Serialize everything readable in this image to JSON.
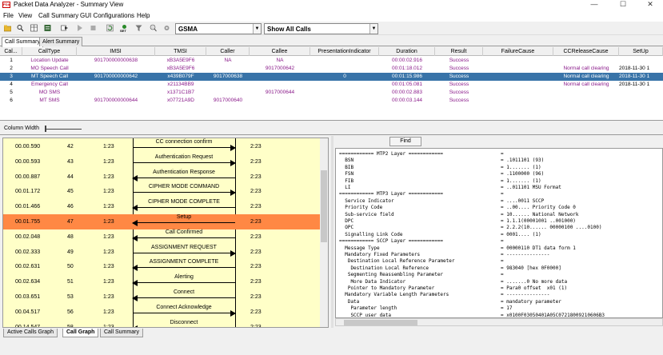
{
  "window": {
    "icon_text": "PDA",
    "title": "Packet Data Analyzer - Summary View",
    "minimize": "—",
    "maximize": "☐",
    "close": "✕"
  },
  "menu": [
    "File",
    "View",
    "Call Summary",
    "GUI Configurations",
    "Help"
  ],
  "toolbar": {
    "protocol_combo": "GSMA",
    "filter_combo": "Show All Calls",
    "set_label": "SET"
  },
  "top_tabs": [
    "Call Summary",
    "Alert Summary"
  ],
  "grid": {
    "headers": [
      "Cal...",
      "CallType",
      "IMSI",
      "TMSI",
      "Caller",
      "Callee",
      "PresentationIndicator",
      "Duration",
      "Result",
      "FailureCause",
      "CCReleaseCause",
      "SetUp"
    ],
    "rows": [
      [
        "1",
        "Location Update",
        "901700000000638",
        "xB3A5E9F6",
        "NA",
        "NA",
        "",
        "00:00:02.916",
        "Success",
        "",
        "",
        ""
      ],
      [
        "2",
        "MO Speech Call",
        "",
        "xB3A5E9F6",
        "",
        "9017000642",
        "",
        "00:01:18.012",
        "Success",
        "",
        "Normal call clearing",
        "2018-11-30 1"
      ],
      [
        "3",
        "MT Speech Call",
        "901700000000642",
        "x439B079F",
        "9017000638",
        "",
        "0",
        "00:01:15.986",
        "Success",
        "",
        "Normal call clearing",
        "2018-11-30 1"
      ],
      [
        "4",
        "Emergency Call",
        "",
        "x21134BB9",
        "",
        "",
        "",
        "00:01:05.081",
        "Success",
        "",
        "Normal call clearing",
        "2018-11-30 1"
      ],
      [
        "5",
        "MO SMS",
        "",
        "x1371C1B7",
        "",
        "9017000644",
        "",
        "00:00:02.883",
        "Success",
        "",
        "",
        ""
      ],
      [
        "6",
        "MT SMS",
        "901700000000644",
        "x07721A9D",
        "9017000640",
        "",
        "",
        "00:00:03.144",
        "Success",
        "",
        "",
        ""
      ]
    ],
    "selected_row": 2
  },
  "column_width_label": "Column Width",
  "find_label": "Find",
  "call_graph": {
    "events": [
      {
        "time": "00.00.590",
        "num": "42",
        "left": "1:23",
        "msg": "CC connection confirm",
        "dir": "right",
        "right": "2:23"
      },
      {
        "time": "00.00.593",
        "num": "43",
        "left": "1:23",
        "msg": "Authentication Request",
        "dir": "right",
        "right": "2:23"
      },
      {
        "time": "00.00.887",
        "num": "44",
        "left": "1:23",
        "msg": "Authentication Response",
        "dir": "left",
        "right": "2:23"
      },
      {
        "time": "00.01.172",
        "num": "45",
        "left": "1:23",
        "msg": "CIPHER MODE COMMAND",
        "dir": "right",
        "right": "2:23"
      },
      {
        "time": "00.01.466",
        "num": "46",
        "left": "1:23",
        "msg": "CIPHER MODE COMPLETE",
        "dir": "left",
        "right": "2:23"
      },
      {
        "time": "00.01.755",
        "num": "47",
        "left": "1:23",
        "msg": "Setup",
        "dir": "left",
        "right": "2:23"
      },
      {
        "time": "00.02.048",
        "num": "48",
        "left": "1:23",
        "msg": "Call Confirmed",
        "dir": "left",
        "right": "2:23"
      },
      {
        "time": "00.02.333",
        "num": "49",
        "left": "1:23",
        "msg": "ASSIGNMENT REQUEST",
        "dir": "right",
        "right": "2:23"
      },
      {
        "time": "00.02.631",
        "num": "50",
        "left": "1:23",
        "msg": "ASSIGNMENT COMPLETE",
        "dir": "left",
        "right": "2:23"
      },
      {
        "time": "00.02.634",
        "num": "51",
        "left": "1:23",
        "msg": "Alerting",
        "dir": "left",
        "right": "2:23"
      },
      {
        "time": "00.03.651",
        "num": "53",
        "left": "1:23",
        "msg": "Connect",
        "dir": "left",
        "right": "2:23"
      },
      {
        "time": "00.04.517",
        "num": "56",
        "left": "1:23",
        "msg": "Connect Acknowledge",
        "dir": "right",
        "right": "2:23"
      },
      {
        "time": "00.14.547",
        "num": "58",
        "left": "1:23",
        "msg": "Disconnect",
        "dir": "left",
        "right": "2:23"
      }
    ],
    "highlight_index": 5
  },
  "bottom_tabs": [
    "Active Calls Graph",
    "Call Graph",
    "Call Summary"
  ],
  "decode": [
    {
      "k": "============ MTP2 Layer ============",
      "v": "="
    },
    {
      "k": "  BSN",
      "v": "= .1011101 (93)"
    },
    {
      "k": "  BIB",
      "v": "= 1....... (1)"
    },
    {
      "k": "  FSN",
      "v": "= .1100000 (96)"
    },
    {
      "k": "  FIB",
      "v": "= 1....... (1)"
    },
    {
      "k": "  LI",
      "v": "= ..011101 MSU Format"
    },
    {
      "k": "============ MTP3 Layer ============",
      "v": "="
    },
    {
      "k": "  Service Indicator",
      "v": "= ....0011 SCCP"
    },
    {
      "k": "  Priority Code",
      "v": "= ..00.... Priority Code 0"
    },
    {
      "k": "  Sub-service field",
      "v": "= 10...... National Network"
    },
    {
      "k": "  DPC",
      "v": "= 1.1.1(00001001 ..001000)"
    },
    {
      "k": "  OPC",
      "v": "= 2.2.2(10...... 00000100 ....0100)"
    },
    {
      "k": "  Signalling Link Code",
      "v": "= 0001.... (1)"
    },
    {
      "k": "============ SCCP Layer ============",
      "v": "="
    },
    {
      "k": "  Message Type",
      "v": "= 00000110 DT1 data form 1"
    },
    {
      "k": "  Mandatory Fixed Parameters",
      "v": "= ---------------"
    },
    {
      "k": "   Destination Local Reference Parameter",
      "v": "="
    },
    {
      "k": "    Destination Local Reference",
      "v": "= 983040 [hex 0F0000]"
    },
    {
      "k": "   Segmenting Reassembling Parameter",
      "v": "="
    },
    {
      "k": "    More Data Indicator",
      "v": "= .......0 No more data"
    },
    {
      "k": "   Pointer to Mandatory Parameter",
      "v": "= Para0 offset  x01 (1)"
    },
    {
      "k": "  Mandatory Variable Length Parameters",
      "v": "= ---------------"
    },
    {
      "k": "   Data",
      "v": "= mandatory parameter"
    },
    {
      "k": "    Parameter length",
      "v": "= 17"
    },
    {
      "k": "    SCCP user data",
      "v": "= x0100F03050401A05C07218009210606B3"
    }
  ]
}
